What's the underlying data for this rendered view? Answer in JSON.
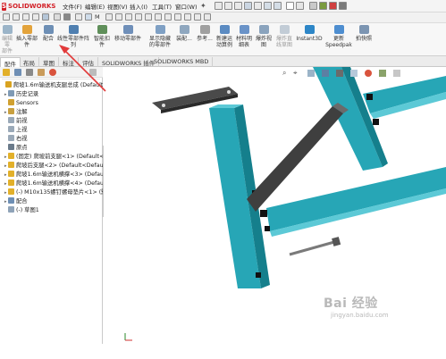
{
  "app": {
    "brand": "SOLIDWORKS",
    "brand_mark": "S"
  },
  "menu": [
    "文件(F)",
    "编辑(E)",
    "视图(V)",
    "插入(I)",
    "工具(T)",
    "窗口(W)"
  ],
  "toolbar_tip": "M",
  "ribbon": [
    {
      "label": "编辑零\n部件",
      "dim": true,
      "color": "#9bb4c8"
    },
    {
      "label": "插入零部件",
      "dim": false,
      "color": "#e3a33b"
    },
    {
      "label": "配合",
      "dim": false,
      "color": "#6e8fb5"
    },
    {
      "label": "线性零部件阵列",
      "dim": false,
      "color": "#4f7fb0"
    },
    {
      "label": "智能扣\n件",
      "dim": false,
      "color": "#5f8f5a"
    },
    {
      "label": "移动零部件",
      "dim": false,
      "color": "#6f8fb9"
    },
    {
      "label": "显示隐藏\n的零部件",
      "dim": false,
      "color": "#7fa0c4"
    },
    {
      "label": "装配...",
      "dim": false,
      "color": "#8fa7bf"
    },
    {
      "label": "参考...",
      "dim": false,
      "color": "#a0a0a0"
    },
    {
      "label": "新建运\n动算例",
      "dim": false,
      "color": "#5b8bc2"
    },
    {
      "label": "材料明\n细表",
      "dim": false,
      "color": "#6a93c8"
    },
    {
      "label": "爆炸视\n图",
      "dim": false,
      "color": "#8aa3bd"
    },
    {
      "label": "爆炸直\n线草图",
      "dim": true,
      "color": "#c2ccd6"
    },
    {
      "label": "Instant3D",
      "dim": false,
      "color": "#2d86c7"
    },
    {
      "label": "更新\nSpeedpak",
      "dim": false,
      "color": "#4e8ed0"
    },
    {
      "label": "拍快照",
      "dim": false,
      "color": "#7c95b2"
    }
  ],
  "tabs": [
    {
      "label": "配件",
      "active": true
    },
    {
      "label": "布局",
      "active": false
    },
    {
      "label": "草图",
      "active": false
    },
    {
      "label": "标注",
      "active": false
    },
    {
      "label": "评估",
      "active": false
    },
    {
      "label": "SOLIDWORKS 插件",
      "active": false
    },
    {
      "label": "SOLIDWORKS MBD",
      "active": false
    }
  ],
  "tree": [
    {
      "label": "爬坡1.6m输送机支腿总成  (Default<Defa",
      "icon": "#d9a320",
      "indent": 0,
      "arrow": ""
    },
    {
      "label": "历史记录",
      "icon": "#7f9ab5",
      "indent": 1,
      "arrow": "▸"
    },
    {
      "label": "Sensors",
      "icon": "#d0a030",
      "indent": 1,
      "arrow": ""
    },
    {
      "label": "注解",
      "icon": "#c8a040",
      "indent": 1,
      "arrow": "▸"
    },
    {
      "label": "前视",
      "icon": "#9aa9b8",
      "indent": 1,
      "arrow": ""
    },
    {
      "label": "上视",
      "icon": "#9aa9b8",
      "indent": 1,
      "arrow": ""
    },
    {
      "label": "右视",
      "icon": "#9aa9b8",
      "indent": 1,
      "arrow": ""
    },
    {
      "label": "原点",
      "icon": "#6a7a8a",
      "indent": 1,
      "arrow": ""
    },
    {
      "label": "(固定) 爬坡前支腿<1> (Default<De",
      "icon": "#e2b02a",
      "indent": 1,
      "arrow": "▸"
    },
    {
      "label": "爬坡后支腿<2> (Default<Default_",
      "icon": "#e2b02a",
      "indent": 1,
      "arrow": "▸"
    },
    {
      "label": "爬坡1.6m输送机横撑<3> (Default<",
      "icon": "#e2b02a",
      "indent": 1,
      "arrow": "▸"
    },
    {
      "label": "爬坡1.6m输送机横撑<4> (Default<",
      "icon": "#e2b02a",
      "indent": 1,
      "arrow": "▸"
    },
    {
      "label": "(-) M10x135螺钉螺母垫片<1> (默认",
      "icon": "#e2b02a",
      "indent": 1,
      "arrow": "▸"
    },
    {
      "label": "配合",
      "icon": "#6e8fb5",
      "indent": 1,
      "arrow": "▸"
    },
    {
      "label": "(-) 草图1",
      "icon": "#8fa3b8",
      "indent": 1,
      "arrow": ""
    }
  ],
  "colors": {
    "steel": "#27a6b6",
    "steel_dark": "#157f8c",
    "steel_light": "#5cc9d6",
    "bar": "#4a4a4a",
    "annotation": "#e23a3a"
  },
  "watermark": "Bai 经验",
  "watermark_sub": "jingyan.baidu.com"
}
